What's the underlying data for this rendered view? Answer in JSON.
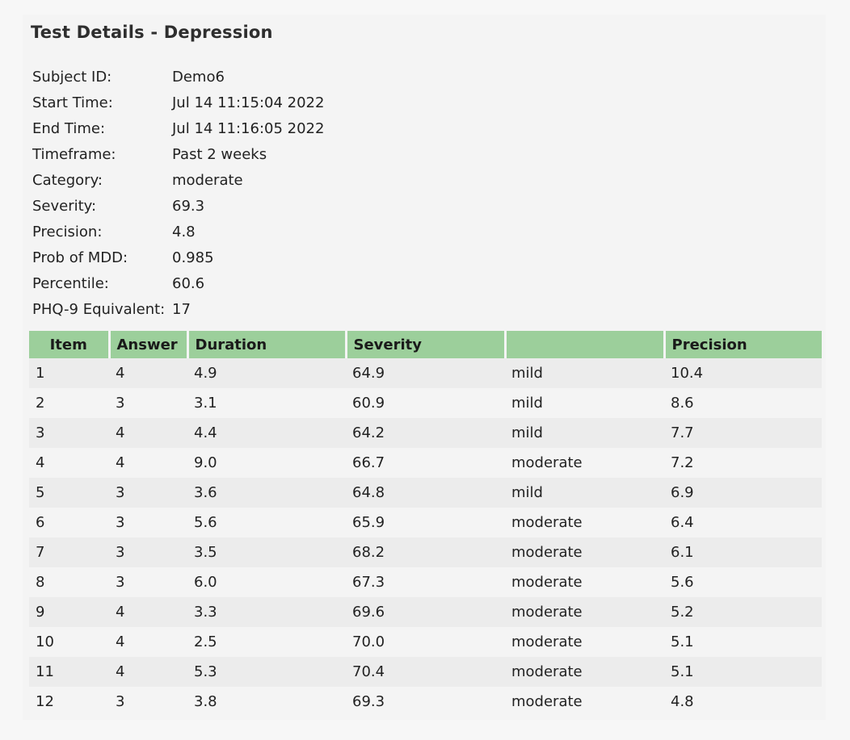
{
  "title": "Test Details - Depression",
  "summary": [
    {
      "label": "Subject ID:",
      "value": "Demo6"
    },
    {
      "label": "Start Time:",
      "value": "Jul 14 11:15:04 2022"
    },
    {
      "label": "End Time:",
      "value": "Jul 14 11:16:05 2022"
    },
    {
      "label": "Timeframe:",
      "value": "Past 2 weeks"
    },
    {
      "label": "Category:",
      "value": "moderate"
    },
    {
      "label": "Severity:",
      "value": "69.3"
    },
    {
      "label": "Precision:",
      "value": "4.8"
    },
    {
      "label": "Prob of MDD:",
      "value": "0.985"
    },
    {
      "label": "Percentile:",
      "value": "60.6"
    },
    {
      "label": "PHQ-9 Equivalent:",
      "value": "17"
    }
  ],
  "table": {
    "columns": [
      "Item",
      "Answer",
      "Duration",
      "Severity",
      "",
      "Precision"
    ],
    "rows": [
      [
        "1",
        "4",
        "4.9",
        "64.9",
        "mild",
        "10.4"
      ],
      [
        "2",
        "3",
        "3.1",
        "60.9",
        "mild",
        "8.6"
      ],
      [
        "3",
        "4",
        "4.4",
        "64.2",
        "mild",
        "7.7"
      ],
      [
        "4",
        "4",
        "9.0",
        "66.7",
        "moderate",
        "7.2"
      ],
      [
        "5",
        "3",
        "3.6",
        "64.8",
        "mild",
        "6.9"
      ],
      [
        "6",
        "3",
        "5.6",
        "65.9",
        "moderate",
        "6.4"
      ],
      [
        "7",
        "3",
        "3.5",
        "68.2",
        "moderate",
        "6.1"
      ],
      [
        "8",
        "3",
        "6.0",
        "67.3",
        "moderate",
        "5.6"
      ],
      [
        "9",
        "4",
        "3.3",
        "69.6",
        "moderate",
        "5.2"
      ],
      [
        "10",
        "4",
        "2.5",
        "70.0",
        "moderate",
        "5.1"
      ],
      [
        "11",
        "4",
        "5.3",
        "70.4",
        "moderate",
        "5.1"
      ],
      [
        "12",
        "3",
        "3.8",
        "69.3",
        "moderate",
        "4.8"
      ]
    ]
  },
  "colors": {
    "header_bg": "#9ccf9b",
    "row_stripe": "#ececec",
    "panel_bg": "#f4f4f4"
  }
}
